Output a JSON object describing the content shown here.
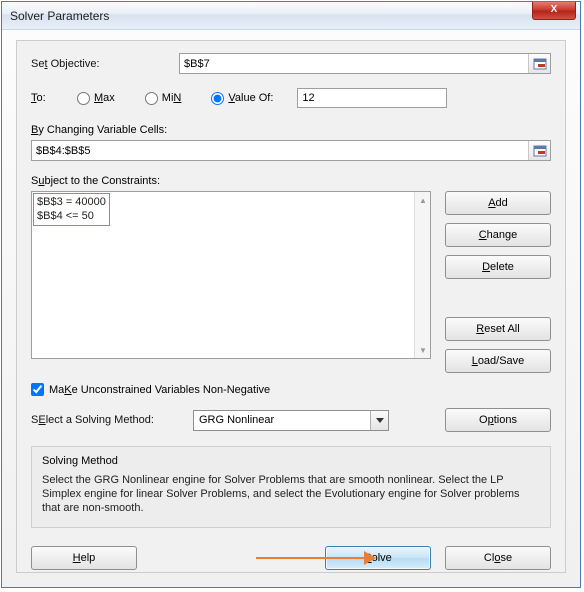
{
  "window": {
    "title": "Solver Parameters"
  },
  "objective": {
    "label": "Set Objective:",
    "underline": "t",
    "value": "$B$7"
  },
  "to": {
    "label": "To:",
    "underline": "T",
    "max": {
      "label": "Max",
      "underline": "M",
      "checked": false
    },
    "min": {
      "label": "Min",
      "underline": "N",
      "checked": false
    },
    "valueof": {
      "label": "Value Of:",
      "underline": "V",
      "checked": true
    },
    "value": "12"
  },
  "cells": {
    "label": "By Changing Variable Cells:",
    "underline": "B",
    "value": "$B$4:$B$5"
  },
  "constraints": {
    "label": "Subject to the Constraints:",
    "underline": "u",
    "items": [
      "$B$3 = 40000",
      "$B$4 <= 50"
    ]
  },
  "buttons": {
    "add": {
      "label": "Add",
      "underline": "A"
    },
    "change": {
      "label": "Change",
      "underline": "C"
    },
    "delete": {
      "label": "Delete",
      "underline": "D"
    },
    "resetall": {
      "label": "Reset All",
      "underline": "R"
    },
    "loadsave": {
      "label": "Load/Save",
      "underline": "L"
    },
    "options": {
      "label": "Options",
      "underline": "p"
    },
    "help": {
      "label": "Help",
      "underline": "H"
    },
    "solve": {
      "label": "Solve",
      "underline": "S"
    },
    "close": {
      "label": "Close",
      "underline": "o"
    }
  },
  "nonneg": {
    "label": "Make Unconstrained Variables Non-Negative",
    "underline": "K",
    "checked": true
  },
  "method": {
    "label": "Select a Solving Method:",
    "underline": "E",
    "value": "GRG Nonlinear"
  },
  "help": {
    "title": "Solving Method",
    "body": "Select the GRG Nonlinear engine for Solver Problems that are smooth nonlinear. Select the LP Simplex engine for linear Solver Problems, and select the Evolutionary engine for Solver problems that are non-smooth."
  },
  "icons": {
    "close_x": "X"
  }
}
